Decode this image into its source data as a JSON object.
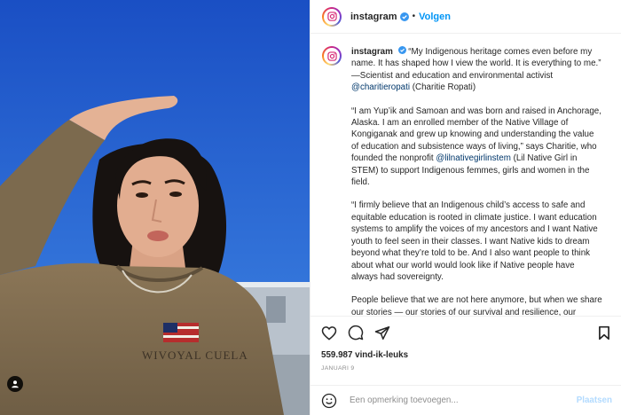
{
  "post": {
    "image_alt": "Portrait of Charitie Ropati shielding her eyes under a blue sky"
  },
  "header": {
    "username": "instagram",
    "separator": "•",
    "follow_label": "Volgen"
  },
  "caption": {
    "username": "instagram",
    "p1_text": "“My Indigenous heritage comes even before my name. It has shaped how I view the world. It is everything to me.” —Scientist and education and environmental activist ",
    "p1_mention": "@charitieropati",
    "p1_after": " (Charitie Ropati)",
    "p2_text": "“I am Yup’ik and Samoan and was born and raised in Anchorage, Alaska. I am an enrolled member of the Native Village of Kongiganak and grew up knowing and understanding the value of education and subsistence ways of living,” says Charitie, who founded the nonprofit ",
    "p2_mention": "@lilnativegirlinstem",
    "p2_after": " (Lil Native Girl in STEM) to support Indigenous femmes, girls and women in the field.",
    "p3_text": "“I firmly believe that an Indigenous child’s access to safe and equitable education is rooted in climate justice. I want education systems to amplify the voices of my ancestors and I want Native youth to feel seen in their classes. I want Native kids to dream beyond what they’re told to be. And I also want people to think about what our world would look like if Native people have always had sovereignty.",
    "p4_text": "People believe that we are not here anymore, but when we share our stories — our stories of our survival and resilience, our stories of joy — people will know that not only are we surviving"
  },
  "actions": {
    "likes": "559.987 vind-ik-leuks",
    "date": "JANUARI 9"
  },
  "comment": {
    "placeholder": "Een opmerking toevoegen...",
    "post_label": "Plaatsen"
  },
  "colors": {
    "link_blue": "#0095f6",
    "mention": "#00376b",
    "verified_blue": "#3897f0",
    "post_disabled": "#b3dbff"
  }
}
